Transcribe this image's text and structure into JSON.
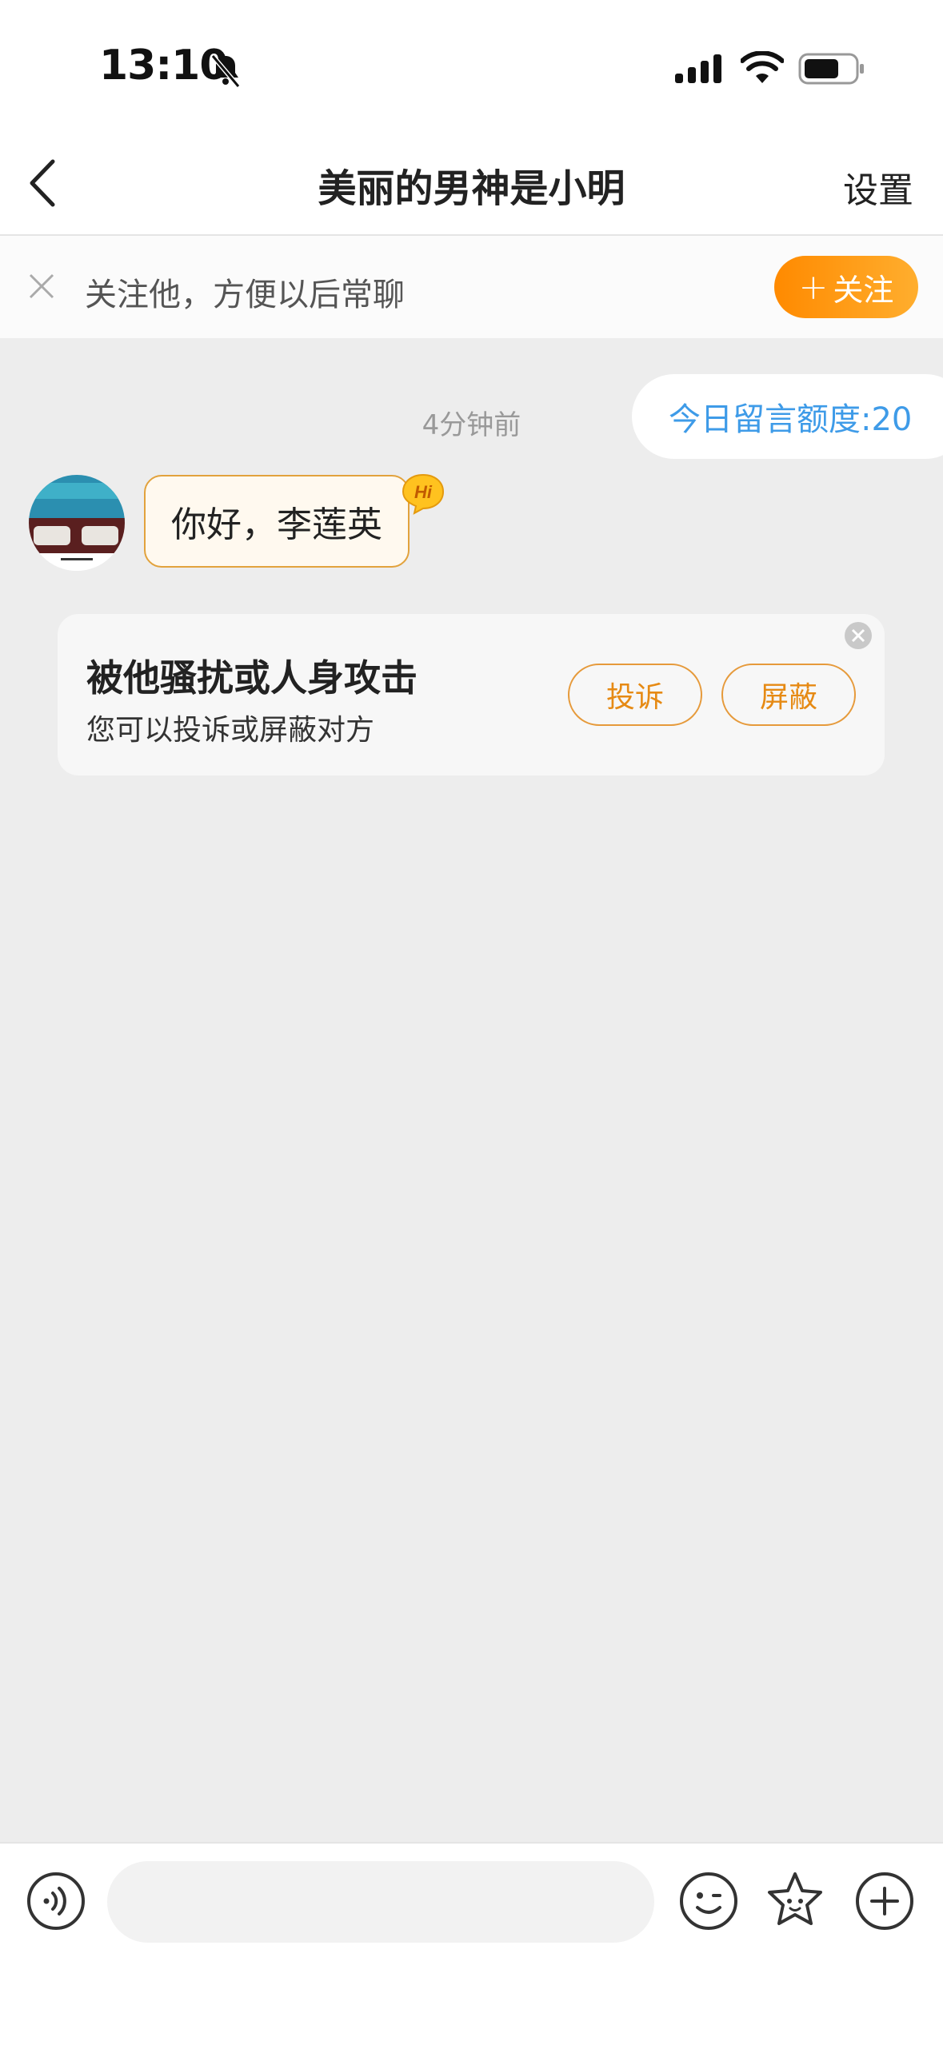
{
  "status_bar": {
    "time": "13:10"
  },
  "header": {
    "title": "美丽的男神是小明",
    "settings_label": "设置"
  },
  "follow_banner": {
    "text": "关注他，方便以后常聊",
    "button_plus": "+",
    "button_label": "关注"
  },
  "quota": {
    "label": "今日留言额度:20"
  },
  "chat": {
    "timestamp": "4分钟前",
    "messages": [
      {
        "text": "你好，李莲英",
        "badge": "Hi"
      }
    ]
  },
  "harassment_card": {
    "title": "被他骚扰或人身攻击",
    "subtitle": "您可以投诉或屏蔽对方",
    "complain_label": "投诉",
    "block_label": "屏蔽"
  },
  "colors": {
    "accent_orange": "#ff8a00",
    "quota_blue": "#3e9be8",
    "background": "#ededed"
  }
}
